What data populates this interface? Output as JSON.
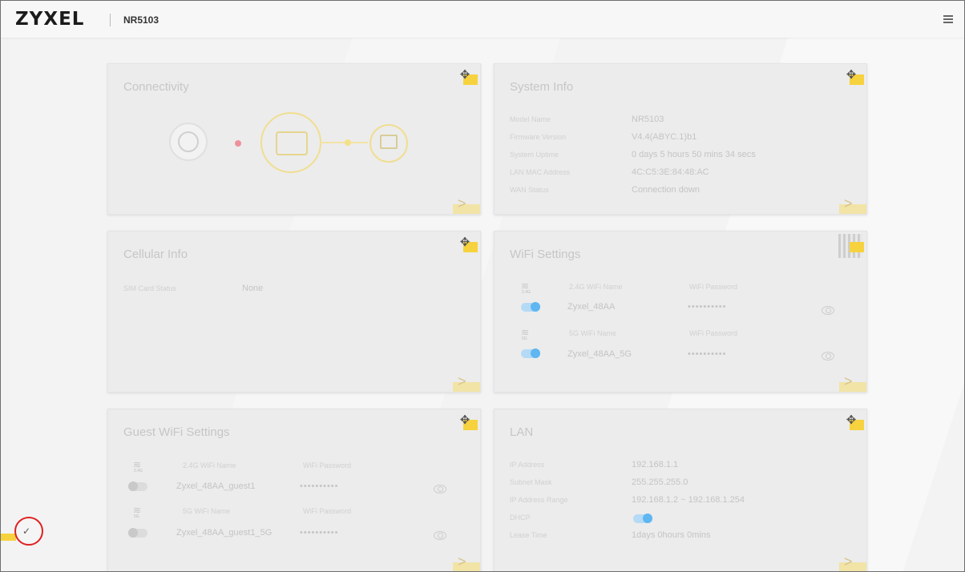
{
  "header": {
    "brand": "ZYXEL",
    "model": "NR5103"
  },
  "icons": {
    "menu": "hamburger-menu-icon",
    "move": "move-arrows-icon",
    "next": "chevron-right-icon",
    "eye": "eye-icon",
    "wifi": "wifi-icon",
    "globe": "globe-icon",
    "router": "router-icon",
    "laptop": "laptop-icon",
    "qr": "qr-code-icon",
    "side": "checkmark-icon"
  },
  "colors": {
    "accent": "#f7d23f",
    "toggle_on": "#5fb6f1",
    "status_dot": "#f06b7c",
    "highlight_ring": "#e02020"
  },
  "connectivity": {
    "title": "Connectivity"
  },
  "system_info": {
    "title": "System Info",
    "rows": [
      {
        "label": "Model Name",
        "value": "NR5103"
      },
      {
        "label": "Firmware Version",
        "value": "V4.4(ABYC.1)b1"
      },
      {
        "label": "System Uptime",
        "value": "0 days 5 hours 50 mins 34 secs"
      },
      {
        "label": "LAN MAC Address",
        "value": "4C:C5:3E:84:48:AC"
      },
      {
        "label": "WAN Status",
        "value": "Connection down"
      }
    ]
  },
  "cellular": {
    "title": "Cellular Info",
    "rows": [
      {
        "label": "SIM Card Status",
        "value": "None"
      }
    ]
  },
  "wifi": {
    "title": "WiFi Settings",
    "bands": [
      {
        "band": "2.4G",
        "name_label": "2.4G WiFi Name",
        "pw_label": "WiFi Password",
        "name": "Zyxel_48AA",
        "password": "••••••••••",
        "enabled": true
      },
      {
        "band": "5G",
        "name_label": "5G WiFi Name",
        "pw_label": "WiFi Password",
        "name": "Zyxel_48AA_5G",
        "password": "••••••••••",
        "enabled": true
      }
    ]
  },
  "guest_wifi": {
    "title": "Guest WiFi Settings",
    "bands": [
      {
        "band": "2.4G",
        "name_label": "2.4G WiFi Name",
        "pw_label": "WiFi Password",
        "name": "Zyxel_48AA_guest1",
        "password": "••••••••••",
        "enabled": false
      },
      {
        "band": "5G",
        "name_label": "5G WiFi Name",
        "pw_label": "WiFi Password",
        "name": "Zyxel_48AA_guest1_5G",
        "password": "••••••••••",
        "enabled": false
      }
    ]
  },
  "lan": {
    "title": "LAN",
    "rows": [
      {
        "label": "IP Address",
        "value": "192.168.1.1"
      },
      {
        "label": "Subnet Mask",
        "value": "255.255.255.0"
      },
      {
        "label": "IP Address Range",
        "value": "192.168.1.2 ~ 192.168.1.254"
      },
      {
        "label": "DHCP",
        "value": ""
      },
      {
        "label": "Lease Time",
        "value": "1days 0hours 0mins"
      }
    ],
    "dhcp_enabled": true
  }
}
